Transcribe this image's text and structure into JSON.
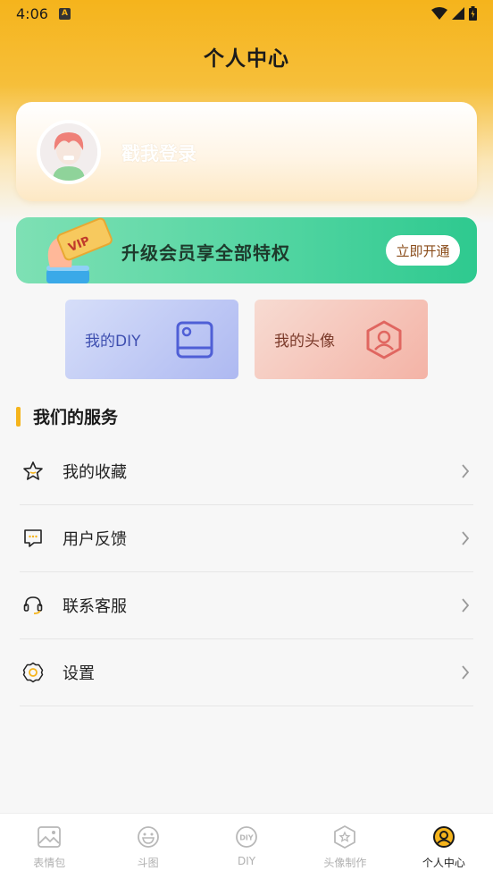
{
  "status_bar": {
    "time": "4:06",
    "icon_label": "A"
  },
  "page": {
    "title": "个人中心"
  },
  "login": {
    "text": "戳我登录"
  },
  "vip": {
    "text": "升级会员享全部特权",
    "button": "立即开通",
    "badge": "VIP"
  },
  "tiles": {
    "diy": "我的DIY",
    "avatar": "我的头像"
  },
  "services": {
    "title": "我们的服务",
    "items": [
      {
        "label": "我的收藏",
        "icon": "star-icon"
      },
      {
        "label": "用户反馈",
        "icon": "feedback-icon"
      },
      {
        "label": "联系客服",
        "icon": "headset-icon"
      },
      {
        "label": "设置",
        "icon": "gear-icon"
      }
    ]
  },
  "tabbar": {
    "items": [
      {
        "label": "表情包",
        "icon": "image-icon"
      },
      {
        "label": "斗图",
        "icon": "smile-icon"
      },
      {
        "label": "DIY",
        "icon": "diy-icon"
      },
      {
        "label": "头像制作",
        "icon": "hexagon-star-icon"
      },
      {
        "label": "个人中心",
        "icon": "user-circle-icon"
      }
    ],
    "active_index": 4
  },
  "colors": {
    "accent": "#f5b41c",
    "vip_green": "#3ccf98"
  }
}
